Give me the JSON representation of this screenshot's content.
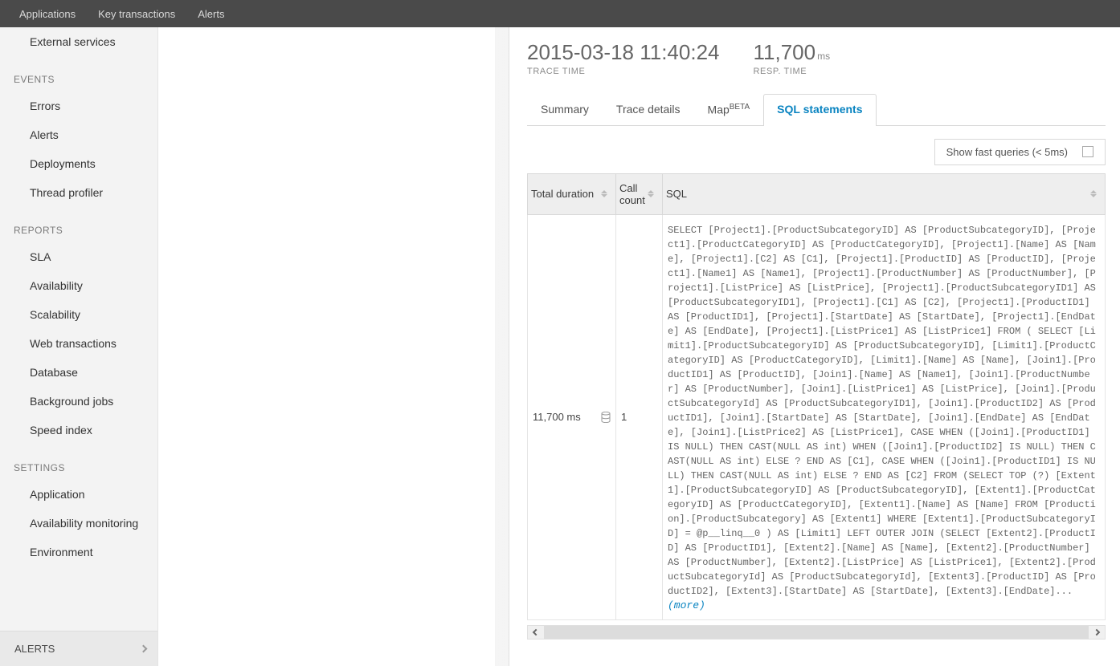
{
  "topnav": {
    "items": [
      "Applications",
      "Key transactions",
      "Alerts"
    ]
  },
  "sidebar": {
    "top_items": [
      "External services"
    ],
    "groups": [
      {
        "label": "EVENTS",
        "items": [
          "Errors",
          "Alerts",
          "Deployments",
          "Thread profiler"
        ]
      },
      {
        "label": "REPORTS",
        "items": [
          "SLA",
          "Availability",
          "Scalability",
          "Web transactions",
          "Database",
          "Background jobs",
          "Speed index"
        ]
      },
      {
        "label": "SETTINGS",
        "items": [
          "Application",
          "Availability monitoring",
          "Environment"
        ]
      }
    ],
    "alerts_footer": "ALERTS"
  },
  "detail": {
    "trace_time_value": "2015-03-18 11:40:24",
    "trace_time_label": "TRACE TIME",
    "resp_time_value": "11,700",
    "resp_time_unit": "ms",
    "resp_time_label": "RESP. TIME",
    "tabs": {
      "summary": "Summary",
      "trace_details": "Trace details",
      "map": "Map",
      "map_badge": "BETA",
      "sql": "SQL statements"
    },
    "fast_queries_label": "Show fast queries (< 5ms)",
    "columns": {
      "duration": "Total duration",
      "count": "Call count",
      "sql": "SQL"
    },
    "row": {
      "duration": "11,700 ms",
      "count": "1",
      "sql": "SELECT [Project1].[ProductSubcategoryID] AS [ProductSubcategoryID], [Project1].[ProductCategoryID] AS [ProductCategoryID], [Project1].[Name] AS [Name], [Project1].[C2] AS [C1], [Project1].[ProductID] AS [ProductID], [Project1].[Name1] AS [Name1], [Project1].[ProductNumber] AS [ProductNumber], [Project1].[ListPrice] AS [ListPrice], [Project1].[ProductSubcategoryID1] AS [ProductSubcategoryID1], [Project1].[C1] AS [C2], [Project1].[ProductID1] AS [ProductID1], [Project1].[StartDate] AS [StartDate], [Project1].[EndDate] AS [EndDate], [Project1].[ListPrice1] AS [ListPrice1] FROM ( SELECT [Limit1].[ProductSubcategoryID] AS [ProductSubcategoryID], [Limit1].[ProductCategoryID] AS [ProductCategoryID], [Limit1].[Name] AS [Name], [Join1].[ProductID1] AS [ProductID], [Join1].[Name] AS [Name1], [Join1].[ProductNumber] AS [ProductNumber], [Join1].[ListPrice1] AS [ListPrice], [Join1].[ProductSubcategoryId] AS [ProductSubcategoryID1], [Join1].[ProductID2] AS [ProductID1], [Join1].[StartDate] AS [StartDate], [Join1].[EndDate] AS [EndDate], [Join1].[ListPrice2] AS [ListPrice1], CASE WHEN ([Join1].[ProductID1] IS NULL) THEN CAST(NULL AS int) WHEN ([Join1].[ProductID2] IS NULL) THEN CAST(NULL AS int) ELSE ? END AS [C1], CASE WHEN ([Join1].[ProductID1] IS NULL) THEN CAST(NULL AS int) ELSE ? END AS [C2] FROM (SELECT TOP (?) [Extent1].[ProductSubcategoryID] AS [ProductSubcategoryID], [Extent1].[ProductCategoryID] AS [ProductCategoryID], [Extent1].[Name] AS [Name] FROM [Production].[ProductSubcategory] AS [Extent1] WHERE [Extent1].[ProductSubcategoryID] = @p__linq__0 ) AS [Limit1] LEFT OUTER JOIN (SELECT [Extent2].[ProductID] AS [ProductID1], [Extent2].[Name] AS [Name], [Extent2].[ProductNumber] AS [ProductNumber], [Extent2].[ListPrice] AS [ListPrice1], [Extent2].[ProductSubcategoryId] AS [ProductSubcategoryId], [Extent3].[ProductID] AS [ProductID2], [Extent3].[StartDate] AS [StartDate], [Extent3].[EndDate]... ",
      "more": "(more)"
    }
  }
}
